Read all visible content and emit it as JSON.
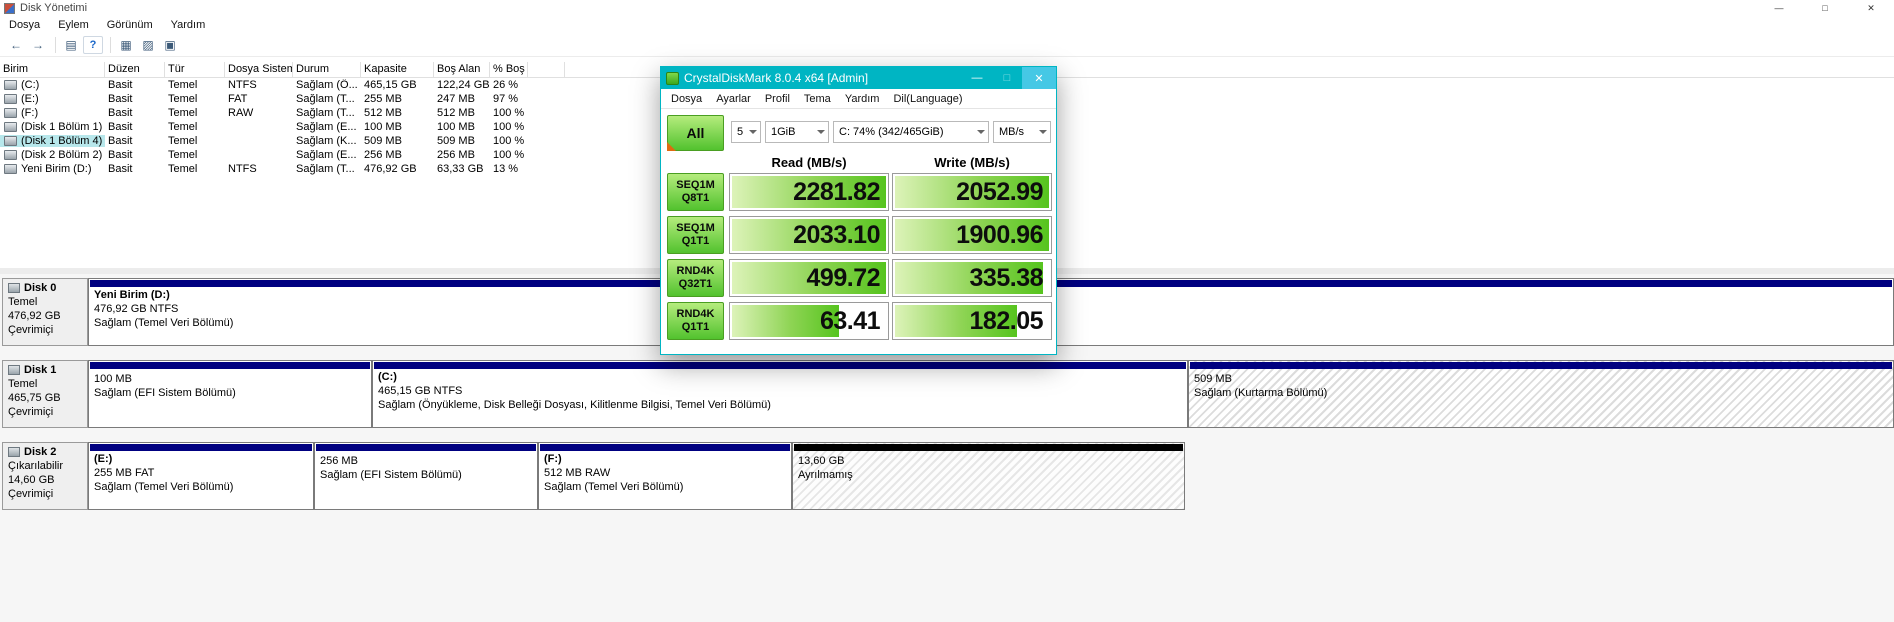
{
  "icons": {
    "minimize": "—",
    "maximize": "□",
    "close": "✕",
    "back": "←",
    "forward": "→",
    "console_tree": "▤",
    "help": "?",
    "list_view": "▦",
    "disk_view": "▨",
    "properties": "▣"
  },
  "colors": {
    "cdm_titlebar": "#00b5c3",
    "cdm_close_button": "#45c8e5",
    "cdm_green": "#52c22e",
    "partition_stripe": "#000080",
    "unallocated_stripe": "#000000",
    "selected_row_highlight": "#b7e7eb"
  },
  "disk_management": {
    "title": "Disk Yönetimi",
    "menu": [
      "Dosya",
      "Eylem",
      "Görünüm",
      "Yardım"
    ],
    "table": {
      "columns": [
        "Birim",
        "Düzen",
        "Tür",
        "Dosya Sistemi",
        "Durum",
        "Kapasite",
        "Boş Alan",
        "% Boş"
      ],
      "rows": [
        [
          "(C:)",
          "Basit",
          "Temel",
          "NTFS",
          "Sağlam (Ö...",
          "465,15 GB",
          "122,24 GB",
          "26 %"
        ],
        [
          "(E:)",
          "Basit",
          "Temel",
          "FAT",
          "Sağlam (T...",
          "255 MB",
          "247 MB",
          "97 %"
        ],
        [
          "(F:)",
          "Basit",
          "Temel",
          "RAW",
          "Sağlam (T...",
          "512 MB",
          "512 MB",
          "100 %"
        ],
        [
          "(Disk 1 Bölüm 1)",
          "Basit",
          "Temel",
          "",
          "Sağlam (E...",
          "100 MB",
          "100 MB",
          "100 %"
        ],
        [
          "(Disk 1 Bölüm 4)",
          "Basit",
          "Temel",
          "",
          "Sağlam (K...",
          "509 MB",
          "509 MB",
          "100 %"
        ],
        [
          "(Disk 2 Bölüm 2)",
          "Basit",
          "Temel",
          "",
          "Sağlam (E...",
          "256 MB",
          "256 MB",
          "100 %"
        ],
        [
          "Yeni Birim (D:)",
          "Basit",
          "Temel",
          "NTFS",
          "Sağlam (T...",
          "476,92 GB",
          "63,33 GB",
          "13 %"
        ]
      ]
    },
    "disks": [
      {
        "name": "Disk 0",
        "lines": [
          "Temel",
          "476,92 GB",
          "Çevrimiçi"
        ],
        "partitions": [
          {
            "name": "Yeni Birim  (D:)",
            "size": "476,92 GB NTFS",
            "status": "Sağlam (Temel Veri Bölümü)"
          }
        ]
      },
      {
        "name": "Disk 1",
        "lines": [
          "Temel",
          "465,75 GB",
          "Çevrimiçi"
        ],
        "partitions": [
          {
            "name": "",
            "size": "100 MB",
            "status": "Sağlam (EFI Sistem Bölümü)"
          },
          {
            "name": "(C:)",
            "size": "465,15 GB NTFS",
            "status": "Sağlam (Önyükleme, Disk Belleği Dosyası, Kilitlenme Bilgisi, Temel Veri Bölümü)"
          },
          {
            "name": "",
            "size": "509 MB",
            "status": "Sağlam (Kurtarma Bölümü)"
          }
        ]
      },
      {
        "name": "Disk 2",
        "lines": [
          "Çıkarılabilir",
          "14,60 GB",
          "Çevrimiçi"
        ],
        "partitions": [
          {
            "name": "(E:)",
            "size": "255 MB FAT",
            "status": "Sağlam (Temel Veri Bölümü)"
          },
          {
            "name": "",
            "size": "256 MB",
            "status": "Sağlam (EFI Sistem Bölümü)"
          },
          {
            "name": "(F:)",
            "size": "512 MB RAW",
            "status": "Sağlam (Temel Veri Bölümü)"
          },
          {
            "name": "",
            "size": "13,60 GB",
            "status": "Ayrılmamış"
          }
        ]
      }
    ]
  },
  "cdm": {
    "title": "CrystalDiskMark 8.0.4 x64 [Admin]",
    "menu": [
      "Dosya",
      "Ayarlar",
      "Profil",
      "Tema",
      "Yardım",
      "Dil(Language)"
    ],
    "all_label": "All",
    "selects": {
      "count": "5",
      "size": "1GiB",
      "target": "C: 74% (342/465GiB)",
      "unit": "MB/s"
    },
    "read_header": "Read (MB/s)",
    "write_header": "Write (MB/s)",
    "tests": [
      {
        "label1": "SEQ1M",
        "label2": "Q8T1",
        "read": "2281.82",
        "write": "2052.99",
        "read_fill": 100,
        "write_fill": 100
      },
      {
        "label1": "SEQ1M",
        "label2": "Q1T1",
        "read": "2033.10",
        "write": "1900.96",
        "read_fill": 100,
        "write_fill": 100
      },
      {
        "label1": "RND4K",
        "label2": "Q32T1",
        "read": "499.72",
        "write": "335.38",
        "read_fill": 100,
        "write_fill": 96
      },
      {
        "label1": "RND4K",
        "label2": "Q1T1",
        "read": "63.41",
        "write": "182.05",
        "read_fill": 70,
        "write_fill": 80
      }
    ]
  }
}
